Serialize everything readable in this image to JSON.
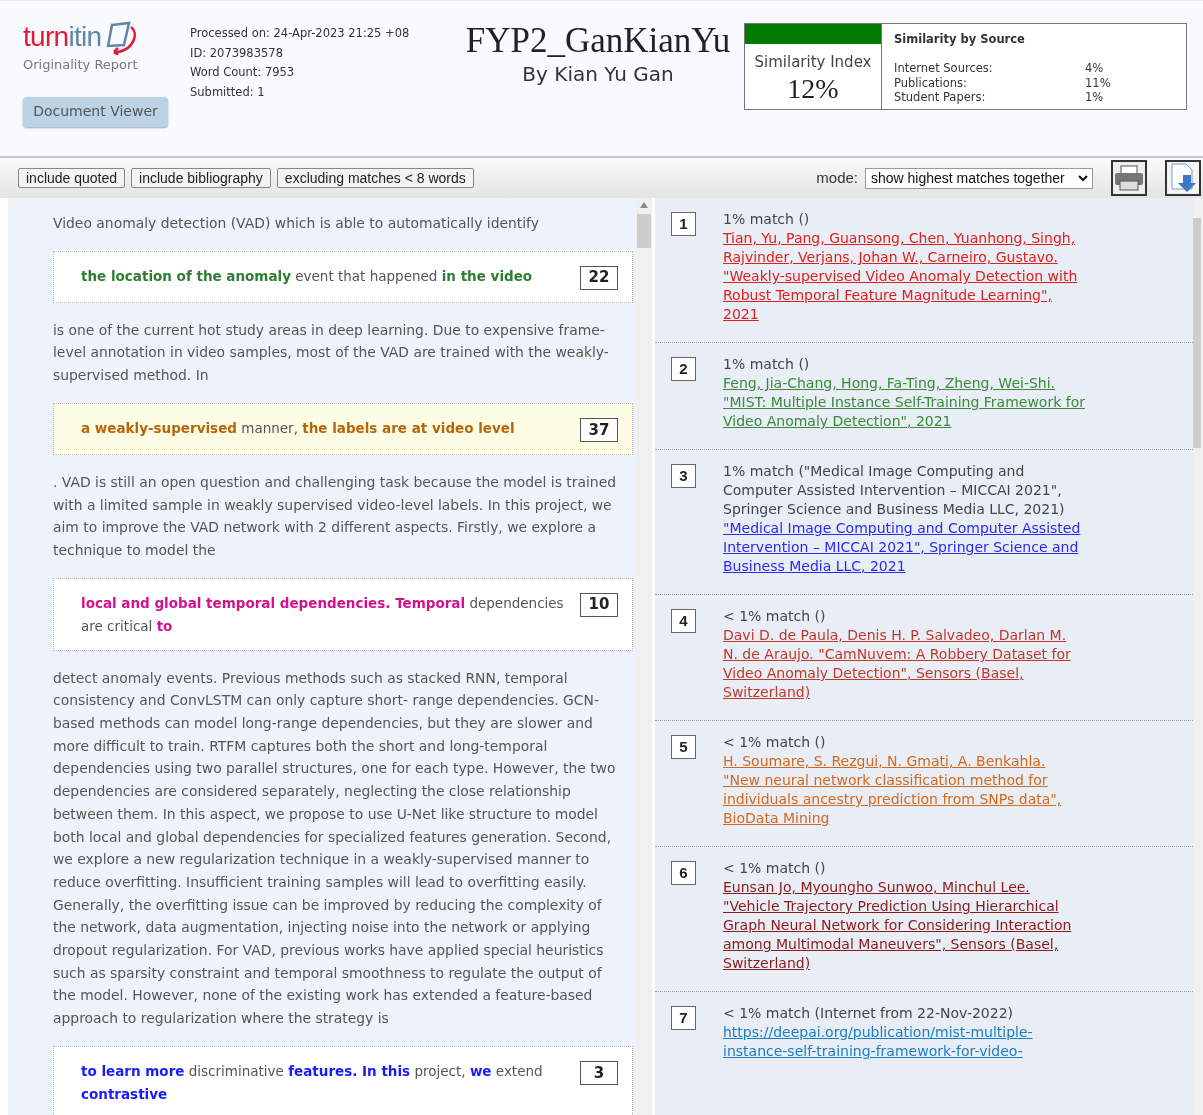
{
  "header": {
    "logo": {
      "wordmark": [
        "turn",
        "itin"
      ],
      "subtitle": "Originality Report"
    },
    "meta": [
      "Processed on: 24-Apr-2023 21:25 +08",
      "ID: 2073983578",
      "Word Count: 7953",
      "Submitted: 1"
    ],
    "document_viewer_button": "Document Viewer",
    "title": "FYP2_GanKianYu",
    "author": "By Kian Yu Gan",
    "similarity_index": {
      "label": "Similarity Index",
      "value": "12%"
    },
    "by_source": {
      "title": "Similarity by Source",
      "rows": [
        {
          "label": "Internet Sources:",
          "value": "4%"
        },
        {
          "label": "Publications:",
          "value": "11%"
        },
        {
          "label": "Student Papers:",
          "value": "1%"
        }
      ]
    }
  },
  "toolbar": {
    "filters": [
      "include quoted",
      "include bibliography",
      "excluding matches < 8 words"
    ],
    "mode_label": "mode:",
    "mode_value": "show highest matches together"
  },
  "document": {
    "blocks": [
      {
        "kind": "text",
        "text": "Video anomaly detection (VAD) which is able to automatically identify"
      },
      {
        "kind": "match",
        "text": "**the location of the anomaly** event that happened **in the video**",
        "number": "22",
        "color": "#2e7d32",
        "selected": false
      },
      {
        "kind": "text",
        "text": "is one of the current hot study areas in deep learning. Due to expensive frame-level annotation in video samples, most of the VAD are trained with the weakly-supervised method. In"
      },
      {
        "kind": "match",
        "text": "**a weakly-supervised** manner, **the labels are at video level**",
        "number": "37",
        "color": "#b8650a",
        "selected": true
      },
      {
        "kind": "text",
        "text": ". VAD is still an open question and challenging task because the model is trained with a limited sample in weakly supervised video-level labels. In this project, we aim to improve the VAD network with 2 different aspects. Firstly, we explore a technique to model the"
      },
      {
        "kind": "match",
        "text": "**local and global temporal dependencies. Temporal** dependencies are critical **to**",
        "number": "10",
        "color": "#d4108f",
        "selected": false
      },
      {
        "kind": "text",
        "text": "detect anomaly events. Previous methods such as stacked RNN, temporal consistency and ConvLSTM can only capture short- range dependencies. GCN-based methods can model long-range dependencies, but they are slower and more difficult to train. RTFM captures both the short and long-temporal dependencies using two parallel structures, one for each type. However, the two dependencies are considered separately, neglecting the close relationship between them. In this aspect, we propose to use U-Net like structure to model both local and global dependencies for specialized features generation. Second, we explore a new regularization technique in a weakly-supervised manner to reduce overfitting. Insufficient training samples will lead to overfitting easily. Generally, the overfitting issue can be improved by reducing the complexity of the network, data augmentation, injecting noise into the network or applying dropout regularization. For VAD, previous works have applied special heuristics such as sparsity constraint and temporal smoothness to regulate the output of the model. However, none of the existing work has extended a feature-based approach to regularization where the strategy is"
      },
      {
        "kind": "match",
        "text": "**to learn more** discriminative **features. In this** project, **we** extend **contrastive**",
        "number": "3",
        "color": "#1a1aff",
        "selected": false
      }
    ]
  },
  "matches": [
    {
      "number": "1",
      "label": "1% match ()",
      "source": "Tian, Yu, Pang, Guansong, Chen, Yuanhong, Singh, Rajvinder, Verjans, Johan W., Carneiro, Gustavo. \"Weakly-supervised Video Anomaly Detection with Robust Temporal Feature Magnitude Learning\", 2021",
      "color": "#e0201c"
    },
    {
      "number": "2",
      "label": "1% match ()",
      "source": "Feng, Jia-Chang, Hong, Fa-Ting, Zheng, Wei-Shi. \"MIST: Multiple Instance Self-Training Framework for Video Anomaly Detection\", 2021",
      "color": "#3a8a3a"
    },
    {
      "number": "3",
      "label": "1% match (\"Medical Image Computing and Computer Assisted Intervention – MICCAI 2021\", Springer Science and Business Media LLC, 2021)",
      "source": "\"Medical Image Computing and Computer Assisted Intervention – MICCAI 2021\", Springer Science and Business Media LLC, 2021",
      "color": "#2b2bf0"
    },
    {
      "number": "4",
      "label": "< 1% match ()",
      "source": "Davi D. de Paula, Denis H. P. Salvadeo, Darlan M. N. de Araujo. \"CamNuvem: A Robbery Dataset for Video Anomaly Detection\", Sensors (Basel, Switzerland)",
      "color": "#c0392b"
    },
    {
      "number": "5",
      "label": "< 1% match ()",
      "source": "H. Soumare, S. Rezgui, N. Gmati, A. Benkahla. \"New neural network classification method for individuals ancestry prediction from SNPs data\", BioData Mining",
      "color": "#d2691e"
    },
    {
      "number": "6",
      "label": "< 1% match ()",
      "source": "Eunsan Jo, Myoungho Sunwoo, Minchul Lee. \"Vehicle Trajectory Prediction Using Hierarchical Graph Neural Network for Considering Interaction among Multimodal Maneuvers\", Sensors (Basel, Switzerland)",
      "color": "#8b1a1a"
    },
    {
      "number": "7",
      "label": "< 1% match (Internet from 22-Nov-2022)",
      "source": "https://deepai.org/publication/mist-multiple-instance-self-training-framework-for-video-",
      "color": "#1a7fc4"
    }
  ]
}
